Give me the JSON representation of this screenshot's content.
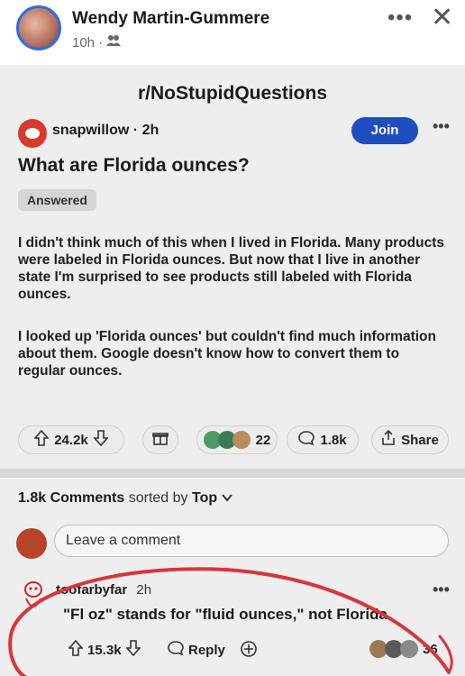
{
  "facebook": {
    "author": "Wendy Martin-Gummere",
    "time": "10h ·",
    "audience_icon": "friends-icon",
    "more_icon": "more-horizontal-icon",
    "close_icon": "close-icon"
  },
  "reddit": {
    "subreddit": "r/NoStupidQuestions",
    "post": {
      "user": "snapwillow · 2h",
      "join_label": "Join",
      "title": "What are Florida ounces?",
      "flair": "Answered",
      "paragraphs": [
        "I didn't think much of this when I lived in Florida. Many products were labeled in Florida ounces. But now that I live in another state I'm surprised to see products still labeled with Florida ounces.",
        "I looked up 'Florida ounces' but couldn't find much information about them. Google doesn't know how to convert them to regular ounces."
      ],
      "votes": "24.2k",
      "awards_count": "22",
      "comments": "1.8k",
      "share_label": "Share"
    },
    "comments_header": {
      "count": "1.8k Comments",
      "sorted_by": "sorted by",
      "sort": "Top"
    },
    "leave_comment_placeholder": "Leave a comment",
    "comment": {
      "user": "toofarbyfar",
      "time": "2h",
      "text": "\"Fl oz\" stands for \"fluid ounces,\" not Florida.",
      "votes": "15.3k",
      "reply_label": "Reply",
      "awards_count": "36"
    }
  },
  "colors": {
    "join_blue": "#1d4fc2",
    "annotation_red": "#d9353b",
    "panel_bg": "#eeeeee"
  }
}
